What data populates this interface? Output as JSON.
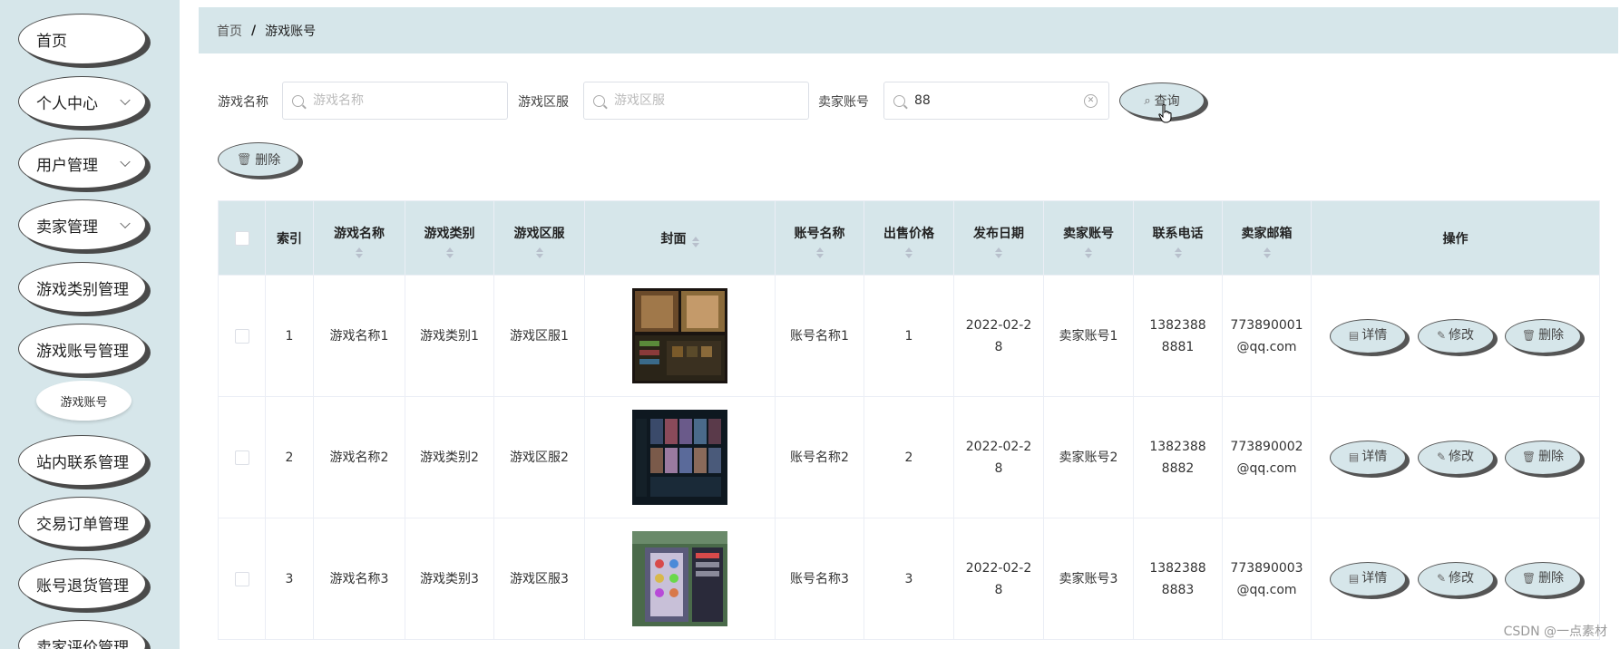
{
  "sidebar": {
    "items": [
      {
        "label": "首页",
        "has_arrow": false
      },
      {
        "label": "个人中心",
        "has_arrow": true
      },
      {
        "label": "用户管理",
        "has_arrow": true
      },
      {
        "label": "卖家管理",
        "has_arrow": true
      },
      {
        "label": "游戏类别管理",
        "has_arrow": false
      },
      {
        "label": "游戏账号管理",
        "has_arrow": false
      },
      {
        "label": "站内联系管理",
        "has_arrow": false
      },
      {
        "label": "交易订单管理",
        "has_arrow": false
      },
      {
        "label": "账号退货管理",
        "has_arrow": false
      },
      {
        "label": "卖家评价管理",
        "has_arrow": false
      }
    ],
    "sub_item": "游戏账号"
  },
  "breadcrumb": {
    "home": "首页",
    "separator": "/",
    "current": "游戏账号"
  },
  "filters": {
    "game_name": {
      "label": "游戏名称",
      "placeholder": "游戏名称",
      "value": ""
    },
    "game_server": {
      "label": "游戏区服",
      "placeholder": "游戏区服",
      "value": ""
    },
    "seller_account": {
      "label": "卖家账号",
      "placeholder": "卖家账号",
      "value": "88"
    },
    "search_label": "查询",
    "delete_label": "删除"
  },
  "table": {
    "headers": {
      "index": "索引",
      "game_name": "游戏名称",
      "category": "游戏类别",
      "server": "游戏区服",
      "cover": "封面",
      "account_name": "账号名称",
      "price": "出售价格",
      "date": "发布日期",
      "seller": "卖家账号",
      "phone": "联系电话",
      "email": "卖家邮箱",
      "ops": "操作"
    },
    "rows": [
      {
        "index": "1",
        "game_name": "游戏名称1",
        "category": "游戏类别1",
        "server": "游戏区服1",
        "account_name": "账号名称1",
        "price": "1",
        "date": "2022-02-28",
        "seller": "卖家账号1",
        "phone": "13823888881",
        "email": "773890001@qq.com"
      },
      {
        "index": "2",
        "game_name": "游戏名称2",
        "category": "游戏类别2",
        "server": "游戏区服2",
        "account_name": "账号名称2",
        "price": "2",
        "date": "2022-02-28",
        "seller": "卖家账号2",
        "phone": "13823888882",
        "email": "773890002@qq.com"
      },
      {
        "index": "3",
        "game_name": "游戏名称3",
        "category": "游戏类别3",
        "server": "游戏区服3",
        "account_name": "账号名称3",
        "price": "3",
        "date": "2022-02-28",
        "seller": "卖家账号3",
        "phone": "13823888883",
        "email": "773890003@qq.com"
      }
    ],
    "actions": {
      "detail": "详情",
      "edit": "修改",
      "delete": "删除"
    }
  },
  "watermark": "CSDN @一点素材",
  "colors": {
    "theme_bg": "#d6e6ea",
    "button_border": "#555555",
    "sidebar_button_bg": "#ffffff"
  }
}
